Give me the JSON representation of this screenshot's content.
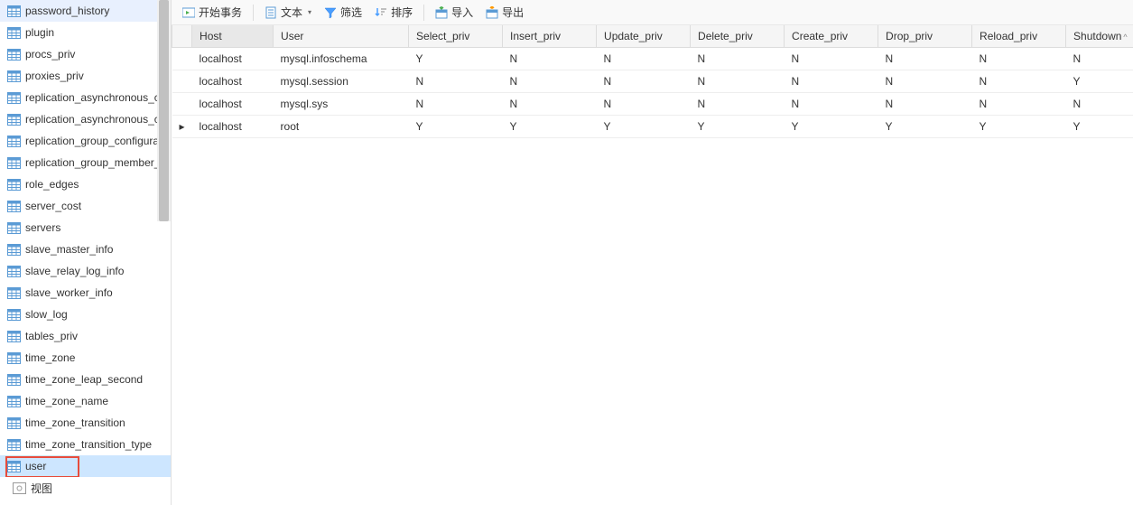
{
  "sidebar": {
    "items": [
      {
        "label": "password_history"
      },
      {
        "label": "plugin"
      },
      {
        "label": "procs_priv"
      },
      {
        "label": "proxies_priv"
      },
      {
        "label": "replication_asynchronous_connection_failover"
      },
      {
        "label": "replication_asynchronous_connection_failover_managed"
      },
      {
        "label": "replication_group_configuration_version"
      },
      {
        "label": "replication_group_member_actions"
      },
      {
        "label": "role_edges"
      },
      {
        "label": "server_cost"
      },
      {
        "label": "servers"
      },
      {
        "label": "slave_master_info"
      },
      {
        "label": "slave_relay_log_info"
      },
      {
        "label": "slave_worker_info"
      },
      {
        "label": "slow_log"
      },
      {
        "label": "tables_priv"
      },
      {
        "label": "time_zone"
      },
      {
        "label": "time_zone_leap_second"
      },
      {
        "label": "time_zone_name"
      },
      {
        "label": "time_zone_transition"
      },
      {
        "label": "time_zone_transition_type"
      },
      {
        "label": "user"
      }
    ],
    "view_label": "视图"
  },
  "toolbar": {
    "begin_tx": "开始事务",
    "text": "文本",
    "filter": "筛选",
    "sort": "排序",
    "import": "导入",
    "export": "导出"
  },
  "grid": {
    "columns": [
      "Host",
      "User",
      "Select_priv",
      "Insert_priv",
      "Update_priv",
      "Delete_priv",
      "Create_priv",
      "Drop_priv",
      "Reload_priv",
      "Shutdown"
    ],
    "rows": [
      {
        "indicator": "",
        "cells": [
          "localhost",
          "mysql.infoschema",
          "Y",
          "N",
          "N",
          "N",
          "N",
          "N",
          "N",
          "N"
        ]
      },
      {
        "indicator": "",
        "cells": [
          "localhost",
          "mysql.session",
          "N",
          "N",
          "N",
          "N",
          "N",
          "N",
          "N",
          "Y"
        ]
      },
      {
        "indicator": "",
        "cells": [
          "localhost",
          "mysql.sys",
          "N",
          "N",
          "N",
          "N",
          "N",
          "N",
          "N",
          "N"
        ]
      },
      {
        "indicator": "▸",
        "cells": [
          "localhost",
          "root",
          "Y",
          "Y",
          "Y",
          "Y",
          "Y",
          "Y",
          "Y",
          "Y"
        ]
      }
    ],
    "sort_indicator": "^"
  }
}
